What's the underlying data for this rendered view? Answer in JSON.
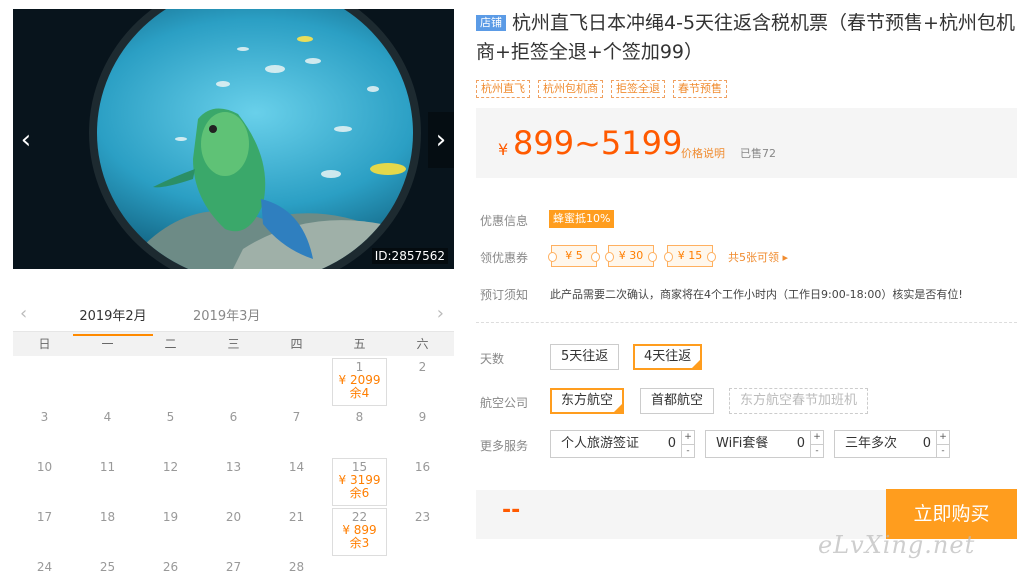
{
  "photo": {
    "id_label": "ID:2857562",
    "prev_glyph": "‹",
    "next_glyph": "›"
  },
  "calendar": {
    "prev_glyph": "‹",
    "next_glyph": "›",
    "months": [
      "2019年2月",
      "2019年3月"
    ],
    "weekdays": [
      "日",
      "一",
      "二",
      "三",
      "四",
      "五",
      "六"
    ],
    "days": [
      {
        "day": ""
      },
      {
        "day": ""
      },
      {
        "day": ""
      },
      {
        "day": ""
      },
      {
        "day": ""
      },
      {
        "day": "1",
        "price": "¥ 2099",
        "stock": "余4"
      },
      {
        "day": "2"
      },
      {
        "day": "3"
      },
      {
        "day": "4"
      },
      {
        "day": "5"
      },
      {
        "day": "6"
      },
      {
        "day": "7"
      },
      {
        "day": "8"
      },
      {
        "day": "9"
      },
      {
        "day": "10"
      },
      {
        "day": "11"
      },
      {
        "day": "12"
      },
      {
        "day": "13"
      },
      {
        "day": "14"
      },
      {
        "day": "15",
        "price": "¥ 3199",
        "stock": "余6"
      },
      {
        "day": "16"
      },
      {
        "day": "17"
      },
      {
        "day": "18"
      },
      {
        "day": "19"
      },
      {
        "day": "20"
      },
      {
        "day": "21"
      },
      {
        "day": "22",
        "price": "¥ 899",
        "stock": "余3"
      },
      {
        "day": "23"
      },
      {
        "day": "24"
      },
      {
        "day": "25"
      },
      {
        "day": "26"
      },
      {
        "day": "27"
      },
      {
        "day": "28"
      }
    ]
  },
  "product": {
    "shop_badge": "店铺",
    "title": "杭州直飞日本冲绳4-5天往返含税机票（春节预售+杭州包机商+拒签全退+个签加99）",
    "tags": [
      "杭州直飞",
      "杭州包机商",
      "拒签全退",
      "春节预售"
    ],
    "currency": "¥",
    "price_range": "899~5199",
    "price_note": "价格说明",
    "sold": "已售72"
  },
  "promo": {
    "discount_label": "优惠信息",
    "discount_badge": "蜂蜜抵10%",
    "coupon_label": "领优惠券",
    "coupons": [
      "¥ 5",
      "¥ 30",
      "¥ 15"
    ],
    "coupon_total": "共5张可领 ▸",
    "notice_label": "预订须知",
    "notice_text": "此产品需要二次确认，商家将在4个工作小时内（工作日9:00-18:00）核实是否有位!"
  },
  "options": {
    "days_label": "天数",
    "days": [
      {
        "label": "5天往返",
        "selected": false
      },
      {
        "label": "4天往返",
        "selected": true
      }
    ],
    "airline_label": "航空公司",
    "airlines": [
      {
        "label": "东方航空",
        "selected": true
      },
      {
        "label": "首都航空",
        "selected": false
      },
      {
        "label": "东方航空春节加班机",
        "disabled": true
      }
    ],
    "services_label": "更多服务",
    "services": [
      {
        "label": "个人旅游签证",
        "qty": "0"
      },
      {
        "label": "WiFi套餐",
        "qty": "0"
      },
      {
        "label": "三年多次",
        "qty": "0"
      }
    ],
    "step_up": "+",
    "step_down": "-"
  },
  "buy": {
    "total": "--",
    "button": "立即购买"
  },
  "watermark": "eLvXing.net",
  "colors": {
    "accent": "#ff9d1e",
    "price": "#ff5a00",
    "badge_blue": "#5b9be6"
  }
}
